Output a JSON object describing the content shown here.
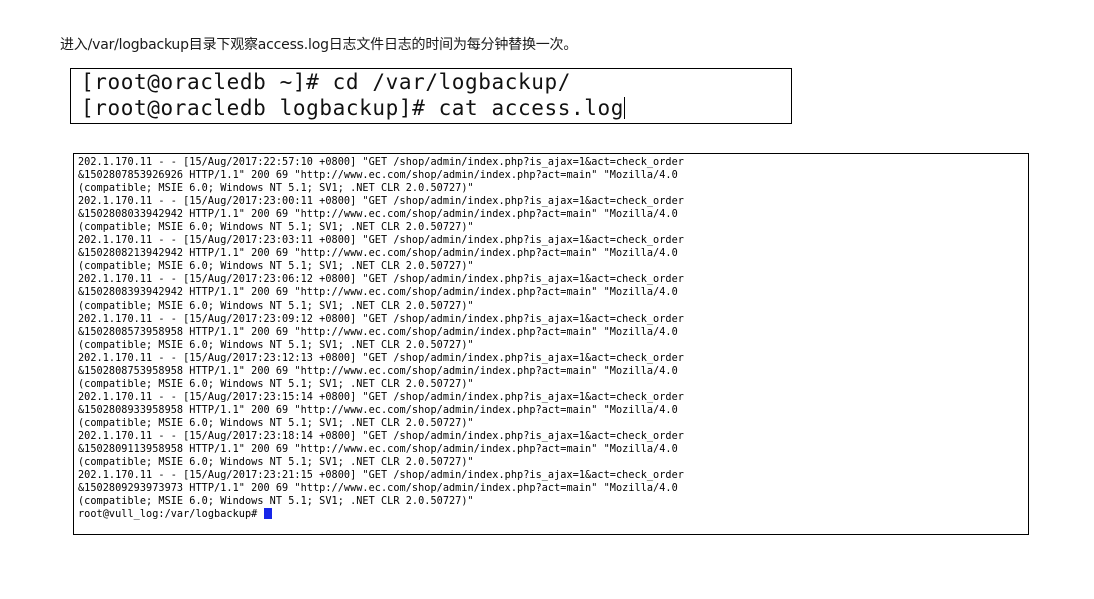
{
  "cut_heading": "",
  "intro_text": "进入/var/logbackup目录下观察access.log日志文件日志的时间为每分钟替换一次。",
  "commands": [
    "[root@oracledb ~]# cd /var/logbackup/",
    "[root@oracledb logbackup]# cat access.log"
  ],
  "log_lines": [
    "202.1.170.11 - - [15/Aug/2017:22:57:10 +0800] \"GET /shop/admin/index.php?is_ajax=1&act=check_order",
    "&1502807853926926 HTTP/1.1\" 200 69 \"http://www.ec.com/shop/admin/index.php?act=main\" \"Mozilla/4.0",
    "(compatible; MSIE 6.0; Windows NT 5.1; SV1; .NET CLR 2.0.50727)\"",
    "202.1.170.11 - - [15/Aug/2017:23:00:11 +0800] \"GET /shop/admin/index.php?is_ajax=1&act=check_order",
    "&1502808033942942 HTTP/1.1\" 200 69 \"http://www.ec.com/shop/admin/index.php?act=main\" \"Mozilla/4.0",
    "(compatible; MSIE 6.0; Windows NT 5.1; SV1; .NET CLR 2.0.50727)\"",
    "202.1.170.11 - - [15/Aug/2017:23:03:11 +0800] \"GET /shop/admin/index.php?is_ajax=1&act=check_order",
    "&1502808213942942 HTTP/1.1\" 200 69 \"http://www.ec.com/shop/admin/index.php?act=main\" \"Mozilla/4.0",
    "(compatible; MSIE 6.0; Windows NT 5.1; SV1; .NET CLR 2.0.50727)\"",
    "202.1.170.11 - - [15/Aug/2017:23:06:12 +0800] \"GET /shop/admin/index.php?is_ajax=1&act=check_order",
    "&1502808393942942 HTTP/1.1\" 200 69 \"http://www.ec.com/shop/admin/index.php?act=main\" \"Mozilla/4.0",
    "(compatible; MSIE 6.0; Windows NT 5.1; SV1; .NET CLR 2.0.50727)\"",
    "202.1.170.11 - - [15/Aug/2017:23:09:12 +0800] \"GET /shop/admin/index.php?is_ajax=1&act=check_order",
    "&1502808573958958 HTTP/1.1\" 200 69 \"http://www.ec.com/shop/admin/index.php?act=main\" \"Mozilla/4.0",
    "(compatible; MSIE 6.0; Windows NT 5.1; SV1; .NET CLR 2.0.50727)\"",
    "202.1.170.11 - - [15/Aug/2017:23:12:13 +0800] \"GET /shop/admin/index.php?is_ajax=1&act=check_order",
    "&1502808753958958 HTTP/1.1\" 200 69 \"http://www.ec.com/shop/admin/index.php?act=main\" \"Mozilla/4.0",
    "(compatible; MSIE 6.0; Windows NT 5.1; SV1; .NET CLR 2.0.50727)\"",
    "202.1.170.11 - - [15/Aug/2017:23:15:14 +0800] \"GET /shop/admin/index.php?is_ajax=1&act=check_order",
    "&1502808933958958 HTTP/1.1\" 200 69 \"http://www.ec.com/shop/admin/index.php?act=main\" \"Mozilla/4.0",
    "(compatible; MSIE 6.0; Windows NT 5.1; SV1; .NET CLR 2.0.50727)\"",
    "202.1.170.11 - - [15/Aug/2017:23:18:14 +0800] \"GET /shop/admin/index.php?is_ajax=1&act=check_order",
    "&1502809113958958 HTTP/1.1\" 200 69 \"http://www.ec.com/shop/admin/index.php?act=main\" \"Mozilla/4.0",
    "(compatible; MSIE 6.0; Windows NT 5.1; SV1; .NET CLR 2.0.50727)\"",
    "202.1.170.11 - - [15/Aug/2017:23:21:15 +0800] \"GET /shop/admin/index.php?is_ajax=1&act=check_order",
    "&1502809293973973 HTTP/1.1\" 200 69 \"http://www.ec.com/shop/admin/index.php?act=main\" \"Mozilla/4.0",
    "(compatible; MSIE 6.0; Windows NT 5.1; SV1; .NET CLR 2.0.50727)\""
  ],
  "final_prompt": "root@vull_log:/var/logbackup# ",
  "colors": {
    "cursor": "#1726e8",
    "border": "#000000"
  }
}
